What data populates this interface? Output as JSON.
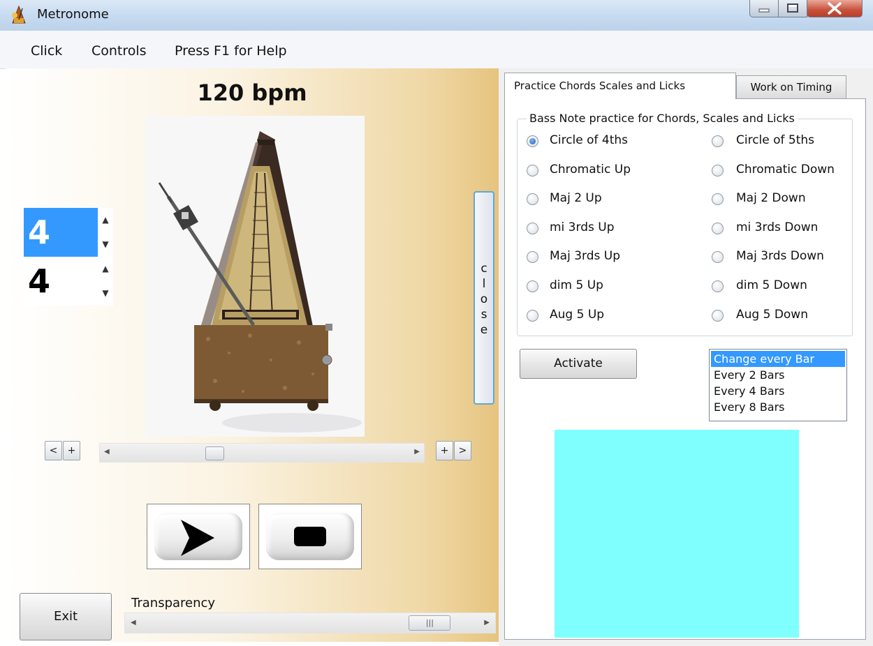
{
  "window": {
    "title": "Metronome",
    "controls": [
      "minimize-icon",
      "maximize-icon",
      "close-icon"
    ]
  },
  "menu": [
    "Click",
    "Controls",
    "Press F1 for Help"
  ],
  "left": {
    "bpm": "120 bpm",
    "time_signature": {
      "top": "4",
      "bottom": "4"
    },
    "side_button": [
      "c",
      "l",
      "o",
      "s",
      "e"
    ],
    "tempo_buttons": {
      "left_prev": "<",
      "left_plus": "+",
      "right_plus": "+",
      "right_next": ">"
    },
    "tempo_position": 0.35,
    "exit": "Exit",
    "transparency_label": "Transparency",
    "transparency_position": 0.9
  },
  "tabs": [
    {
      "label": "Practice Chords  Scales and Licks",
      "active": true
    },
    {
      "label": "Work on Timing",
      "active": false
    }
  ],
  "practice": {
    "group_title": "Bass Note practice for Chords, Scales and Licks",
    "options_left": [
      "Circle of 4ths",
      "Chromatic Up",
      "Maj 2 Up",
      "mi 3rds Up",
      "Maj 3rds Up",
      "dim 5 Up",
      "Aug 5 Up"
    ],
    "options_right": [
      "Circle of 5ths",
      "Chromatic Down",
      "Maj 2 Down",
      "mi 3rds Down",
      "Maj 3rds Down",
      "dim 5 Down",
      "Aug 5 Down"
    ],
    "selected": "Circle of 4ths",
    "activate": "Activate",
    "change_options": [
      "Change every Bar",
      "Every 2 Bars",
      "Every 4 Bars",
      "Every 8 Bars"
    ],
    "change_selected": "Change every Bar",
    "display_color": "#80ffff"
  },
  "colors": {
    "accent": "#3399ff"
  }
}
